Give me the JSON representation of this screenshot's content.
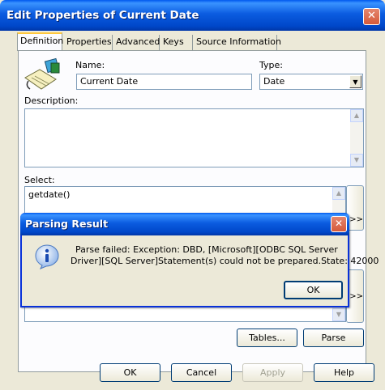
{
  "window": {
    "title": "Edit Properties of Current Date",
    "close_glyph": "✕"
  },
  "tabs": [
    {
      "label": "Definition"
    },
    {
      "label": "Properties"
    },
    {
      "label": "Advanced"
    },
    {
      "label": "Keys"
    },
    {
      "label": "Source Information"
    }
  ],
  "form": {
    "name_label": "Name:",
    "name_value": "Current Date",
    "type_label": "Type:",
    "type_value": "Date",
    "description_label": "Description:",
    "description_value": "",
    "select_label": "Select:",
    "select_value": "getdate()",
    "side_button_1": ">>",
    "side_button_2": ">>"
  },
  "buttons": {
    "tables": "Tables...",
    "parse": "Parse",
    "ok": "OK",
    "cancel": "Cancel",
    "apply": "Apply",
    "help": "Help"
  },
  "dialog": {
    "title": "Parsing Result",
    "close_glyph": "✕",
    "message_line1": "Parse failed: Exception: DBD, [Microsoft][ODBC SQL Server",
    "message_line2": "Driver][SQL Server]Statement(s) could not be prepared.State: 42000",
    "ok_label": "OK"
  },
  "icons": {
    "object_icon": "object-definition-icon",
    "info_icon": "info-icon"
  }
}
